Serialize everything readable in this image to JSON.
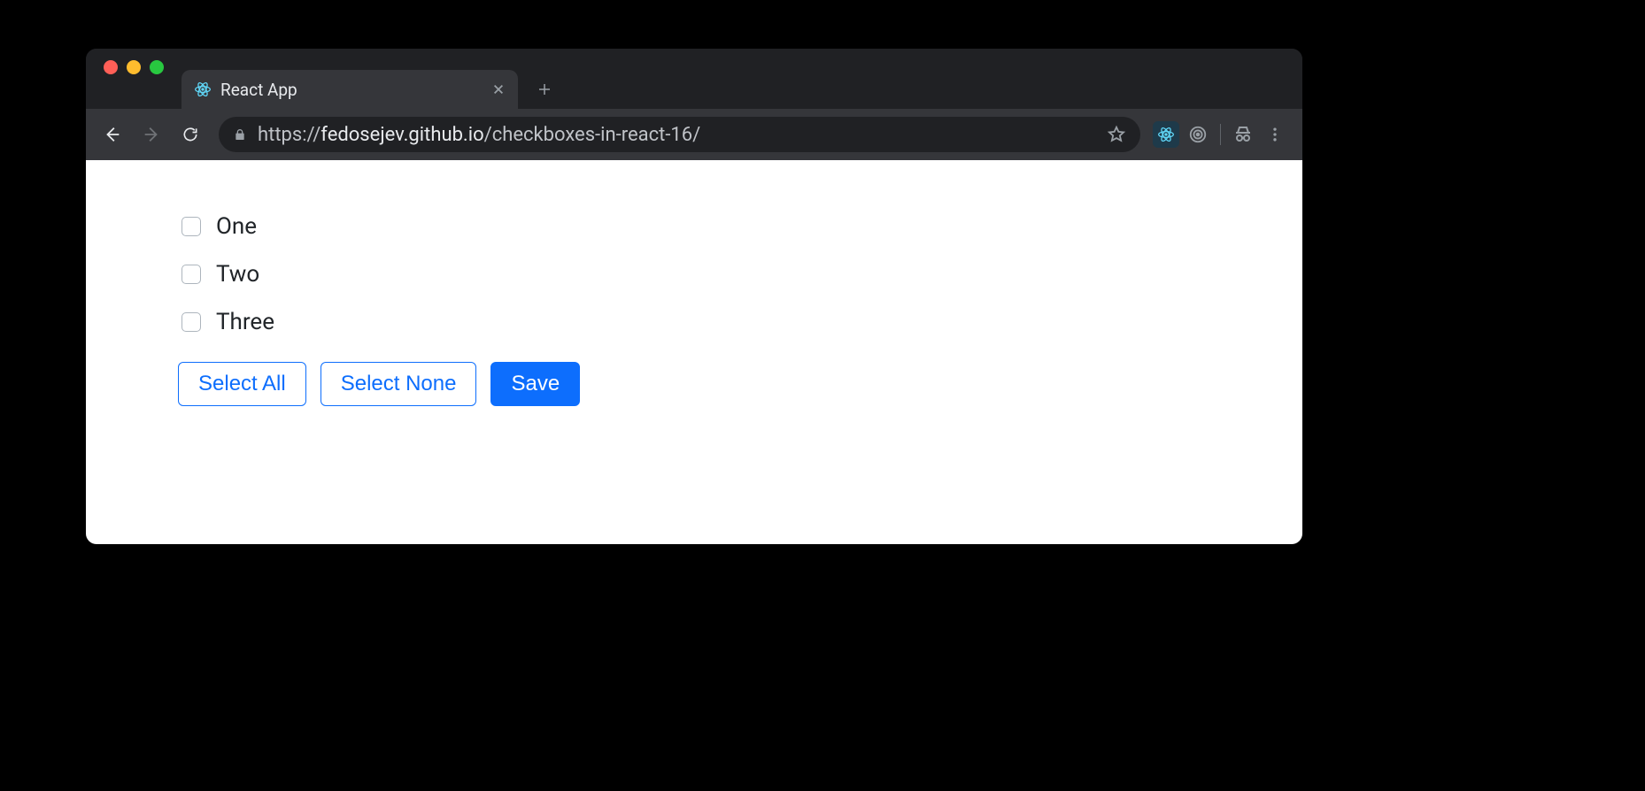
{
  "window": {
    "tab": {
      "title": "React App"
    },
    "url": {
      "scheme": "https://",
      "host": "fedosejev.github.io",
      "path": "/checkboxes-in-react-16/"
    }
  },
  "page": {
    "options": [
      {
        "label": "One",
        "checked": false
      },
      {
        "label": "Two",
        "checked": false
      },
      {
        "label": "Three",
        "checked": false
      }
    ],
    "buttons": {
      "select_all": "Select All",
      "select_none": "Select None",
      "save": "Save"
    }
  }
}
